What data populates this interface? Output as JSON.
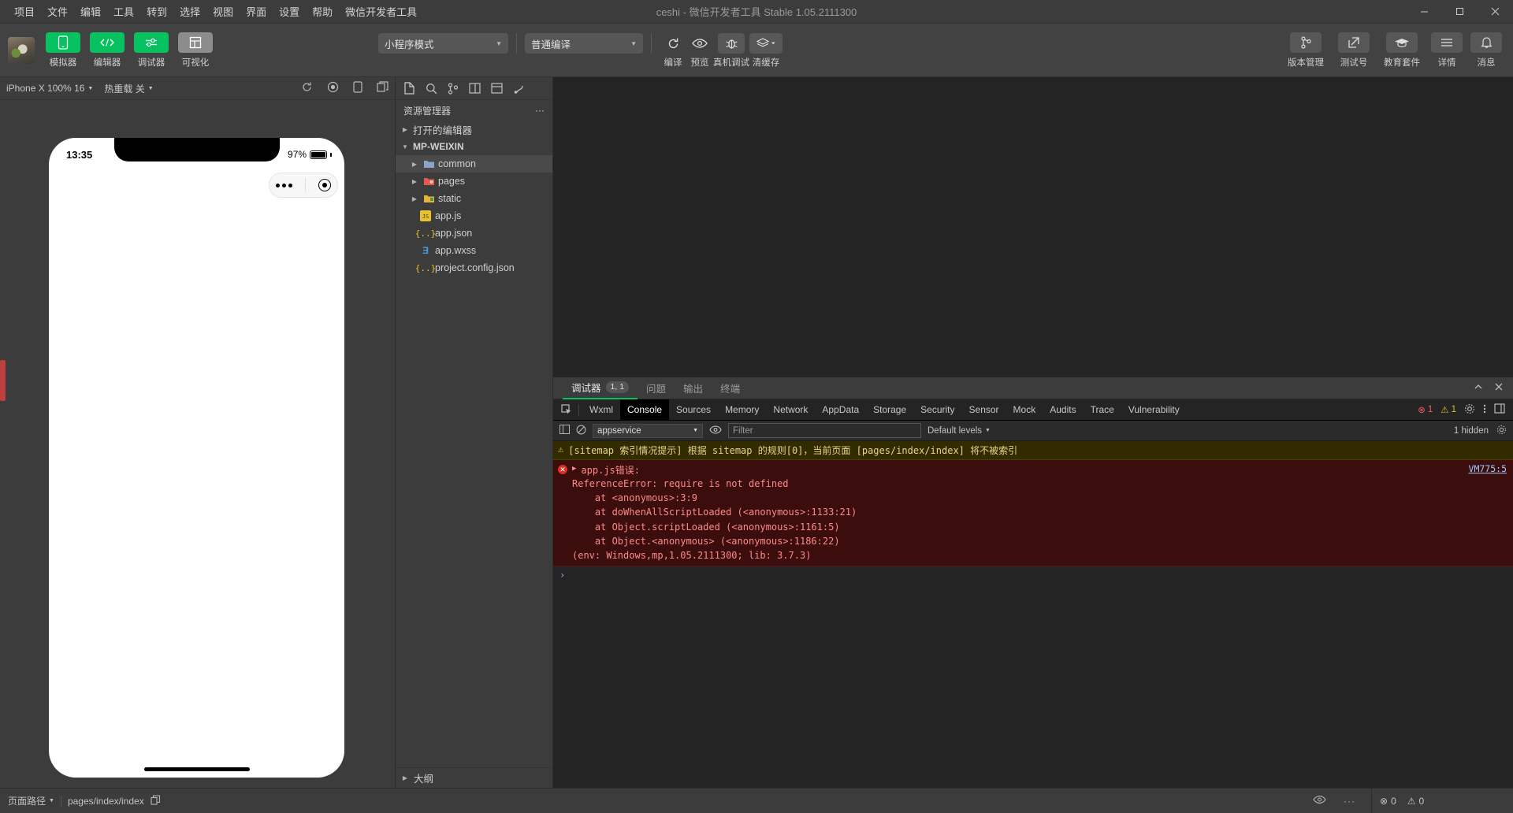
{
  "titlebar": {
    "menus": [
      "项目",
      "文件",
      "编辑",
      "工具",
      "转到",
      "选择",
      "视图",
      "界面",
      "设置",
      "帮助",
      "微信开发者工具"
    ],
    "window_title": "ceshi - 微信开发者工具 Stable 1.05.2111300",
    "minimize": "–",
    "maximize": "▢",
    "close": "✕"
  },
  "toolbar": {
    "left_buttons": [
      {
        "label": "模拟器",
        "icon": "phone-icon",
        "style": "green"
      },
      {
        "label": "编辑器",
        "icon": "code-icon",
        "style": "green"
      },
      {
        "label": "调试器",
        "icon": "sliders-icon",
        "style": "green"
      },
      {
        "label": "可视化",
        "icon": "layout-icon",
        "style": "grey"
      }
    ],
    "mode_select": "小程序模式",
    "compile_select": "普通编译",
    "center_buttons": [
      {
        "label": "编译",
        "icon": "refresh-icon"
      },
      {
        "label": "预览",
        "icon": "eye-icon"
      },
      {
        "label": "真机调试",
        "icon": "bug-icon"
      },
      {
        "label": "清缓存",
        "icon": "layers-icon"
      }
    ],
    "right_buttons": [
      {
        "label": "版本管理",
        "icon": "branch-icon"
      },
      {
        "label": "测试号",
        "icon": "external-link-icon"
      },
      {
        "label": "教育套件",
        "icon": "graduation-cap-icon"
      },
      {
        "label": "详情",
        "icon": "menu-icon"
      },
      {
        "label": "消息",
        "icon": "bell-icon"
      }
    ]
  },
  "simulator": {
    "device_select": "iPhone X 100% 16",
    "hotreload_select": "热重载 关",
    "phone": {
      "time": "13:35",
      "battery": "97%",
      "capsule_dots": "•••",
      "capsule_target": "target-icon"
    }
  },
  "explorer": {
    "toolbar_icons": [
      "files-icon",
      "search-icon",
      "source-control-icon",
      "split-editor-icon",
      "collapse-icon",
      "paint-icon"
    ],
    "title": "资源管理器",
    "more": "···",
    "tree": [
      {
        "label": "打开的编辑器",
        "arrow": "▶",
        "type": "group",
        "indent": 0,
        "selected": false
      },
      {
        "label": "MP-WEIXIN",
        "arrow": "▼",
        "type": "root",
        "indent": 0,
        "selected": false
      },
      {
        "label": "common",
        "arrow": "▶",
        "type": "folder-blue",
        "indent": 1,
        "selected": true
      },
      {
        "label": "pages",
        "arrow": "▶",
        "type": "folder-red",
        "indent": 1,
        "selected": false
      },
      {
        "label": "static",
        "arrow": "▶",
        "type": "folder-yellow",
        "indent": 1,
        "selected": false
      },
      {
        "label": "app.js",
        "arrow": "",
        "type": "js",
        "indent": 1,
        "selected": false
      },
      {
        "label": "app.json",
        "arrow": "",
        "type": "json",
        "indent": 1,
        "selected": false
      },
      {
        "label": "app.wxss",
        "arrow": "",
        "type": "wxss",
        "indent": 1,
        "selected": false
      },
      {
        "label": "project.config.json",
        "arrow": "",
        "type": "json",
        "indent": 1,
        "selected": false
      }
    ],
    "outline": {
      "label": "大纲",
      "arrow": "▶"
    }
  },
  "devtools": {
    "panel_tabs": [
      {
        "label": "调试器",
        "badge": "1, 1",
        "active": true
      },
      {
        "label": "问题",
        "badge": "",
        "active": false
      },
      {
        "label": "输出",
        "badge": "",
        "active": false
      },
      {
        "label": "终端",
        "badge": "",
        "active": false
      }
    ],
    "panel_controls": [
      "chevron-up-icon",
      "close-icon"
    ],
    "inspect_icon": "inspect-element-icon",
    "tabs": [
      "Wxml",
      "Console",
      "Sources",
      "Memory",
      "Network",
      "AppData",
      "Storage",
      "Security",
      "Sensor",
      "Mock",
      "Audits",
      "Trace",
      "Vulnerability"
    ],
    "active_tab": "Console",
    "error_count": "1",
    "warning_count": "1",
    "settings_icon": "gear-icon",
    "kebab_icon": "more-vertical-icon",
    "dock_icon": "dock-panel-icon",
    "filter": {
      "clear_icon": "clear-console-icon",
      "sidebar_icon": "console-sidebar-icon",
      "context": "appservice",
      "eye_icon": "eye-icon",
      "placeholder": "Filter",
      "levels": "Default levels",
      "hidden_count": "1 hidden",
      "settings_icon": "console-settings-icon"
    },
    "messages": {
      "warning": "[sitemap 索引情况提示] 根据 sitemap 的规则[0]，当前页面 [pages/index/index] 将不被索引",
      "error_title": "app.js错误:",
      "error_expand": "▶",
      "error_body": "ReferenceError: require is not defined\n    at <anonymous>:3:9\n    at doWhenAllScriptLoaded (<anonymous>:1133:21)\n    at Object.scriptLoaded (<anonymous>:1161:5)\n    at Object.<anonymous> (<anonymous>:1186:22)\n(env: Windows,mp,1.05.2111300; lib: 3.7.3)",
      "vm_link": "VM775:5",
      "prompt": "›"
    }
  },
  "statusbar": {
    "page_path_label": "页面路径",
    "page_path_value": "pages/index/index",
    "copy_icon": "copy-icon",
    "eye_icon": "eye-icon",
    "more_icon": "more-icon",
    "error_count": "0",
    "warning_count": "0"
  },
  "colors": {
    "accent_green": "#07c160",
    "error_red": "#d93025",
    "warning_yellow": "#e2b93d",
    "panel_bg": "#3c3c3c",
    "console_bg": "#242424"
  }
}
